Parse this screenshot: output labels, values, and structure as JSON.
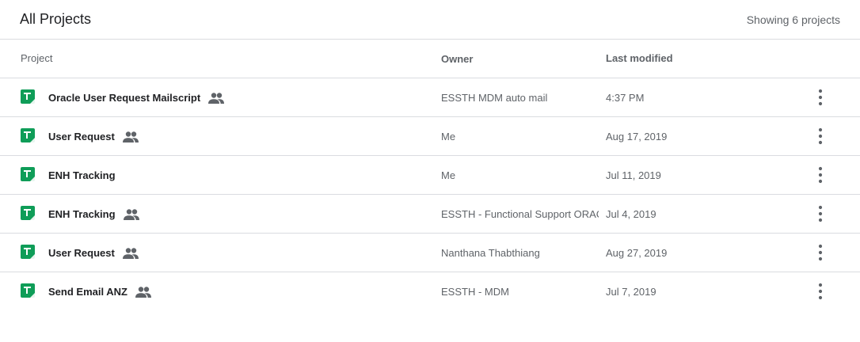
{
  "header": {
    "title": "All Projects",
    "count_text": "Showing 6 projects"
  },
  "columns": {
    "project": "Project",
    "owner": "Owner",
    "last_modified": "Last modified"
  },
  "colors": {
    "file_icon": "#0f9d58",
    "shared_icon": "#5f6368",
    "divider": "#dadce0"
  },
  "icons": {
    "file": "apps-script-file-icon",
    "shared": "people-icon",
    "more": "more-vert-icon"
  },
  "projects": [
    {
      "name": "Oracle User Request Mailscript",
      "shared": true,
      "owner": "ESSTH MDM auto mail",
      "modified": "4:37 PM"
    },
    {
      "name": "User Request",
      "shared": true,
      "owner": "Me",
      "modified": "Aug 17, 2019"
    },
    {
      "name": "ENH Tracking",
      "shared": false,
      "owner": "Me",
      "modified": "Jul 11, 2019"
    },
    {
      "name": "ENH Tracking",
      "shared": true,
      "owner": "ESSTH - Functional Support ORAC",
      "modified": "Jul 4, 2019"
    },
    {
      "name": "User Request",
      "shared": true,
      "owner": "Nanthana Thabthiang",
      "modified": "Aug 27, 2019"
    },
    {
      "name": "Send Email ANZ",
      "shared": true,
      "owner": "ESSTH - MDM",
      "modified": "Jul 7, 2019"
    }
  ]
}
